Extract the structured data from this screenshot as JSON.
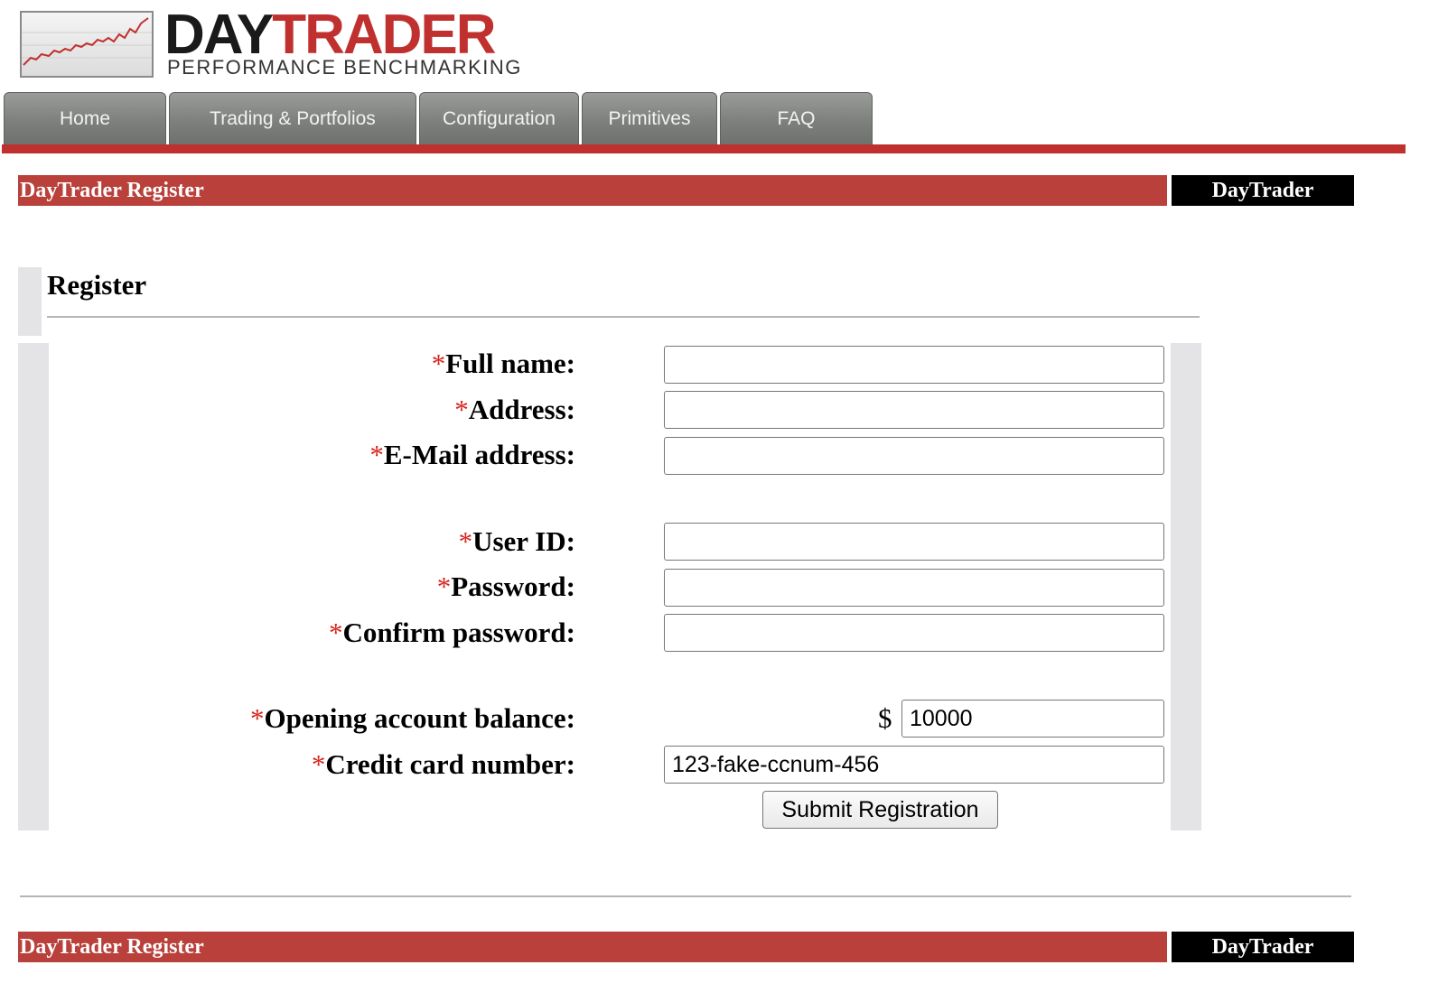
{
  "logo": {
    "word_day": "DAY",
    "word_trader": "TRADER",
    "tagline": "PERFORMANCE BENCHMARKING"
  },
  "nav": {
    "tabs": [
      {
        "label": "Home"
      },
      {
        "label": "Trading & Portfolios"
      },
      {
        "label": "Configuration"
      },
      {
        "label": "Primitives"
      },
      {
        "label": "FAQ"
      }
    ]
  },
  "banner": {
    "title": "DayTrader Register",
    "brand": "DayTrader"
  },
  "page": {
    "title": "Register"
  },
  "form": {
    "required_mark": "*",
    "full_name": {
      "label": "Full name:",
      "value": ""
    },
    "address": {
      "label": "Address:",
      "value": ""
    },
    "email": {
      "label": "E-Mail address:",
      "value": ""
    },
    "user_id": {
      "label": "User ID:",
      "value": ""
    },
    "password": {
      "label": "Password:",
      "value": ""
    },
    "confirm_password": {
      "label": "Confirm password:",
      "value": ""
    },
    "balance": {
      "label": "Opening account balance:",
      "currency": "$",
      "value": "10000"
    },
    "credit_card": {
      "label": "Credit card number:",
      "value": "123-fake-ccnum-456"
    },
    "submit_label": "Submit Registration"
  },
  "footer": {
    "title": "DayTrader Register",
    "brand": "DayTrader"
  },
  "colors": {
    "brand_red": "#c0302e",
    "banner_red": "#b9403b",
    "required_red": "#d6261f"
  }
}
